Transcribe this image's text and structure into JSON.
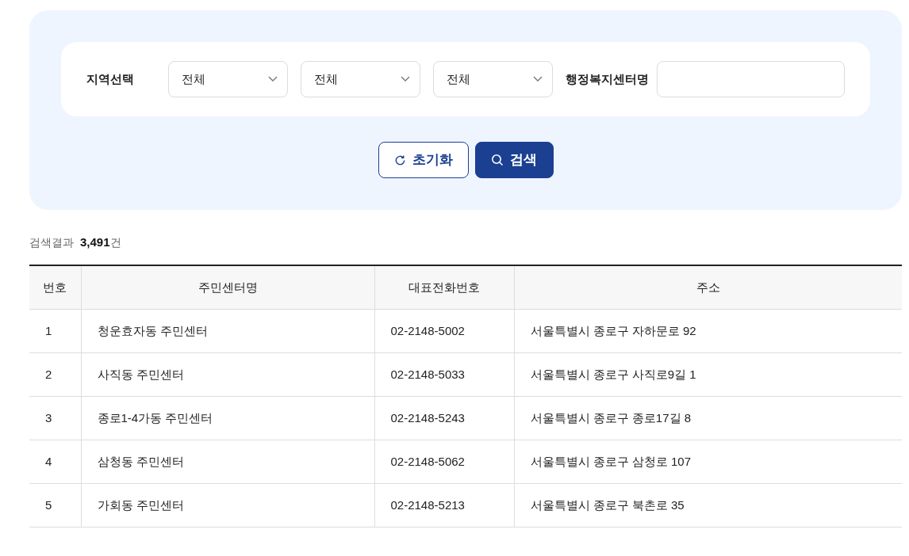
{
  "filter": {
    "region_label": "지역선택",
    "selects": [
      {
        "value": "전체"
      },
      {
        "value": "전체"
      },
      {
        "value": "전체"
      }
    ],
    "center_label": "행정복지센터명",
    "buttons": [
      {
        "kind": "reset",
        "label": "초기화"
      },
      {
        "kind": "search",
        "label": "검색"
      }
    ]
  },
  "result": {
    "label": "검색결과",
    "count": "3,491",
    "unit": "건"
  },
  "table": {
    "columns": [
      "번호",
      "주민센터명",
      "대표전화번호",
      "주소"
    ],
    "rows": [
      [
        "1",
        "청운효자동 주민센터",
        "02-2148-5002",
        "서울특별시 종로구 자하문로 92"
      ],
      [
        "2",
        "사직동 주민센터",
        "02-2148-5033",
        "서울특별시 종로구 사직로9길 1"
      ],
      [
        "3",
        "종로1-4가동 주민센터",
        "02-2148-5243",
        "서울특별시 종로구 종로17길 8"
      ],
      [
        "4",
        "삼청동 주민센터",
        "02-2148-5062",
        "서울특별시 종로구 삼청로 107"
      ],
      [
        "5",
        "가회동 주민센터",
        "02-2148-5213",
        "서울특별시 종로구 북촌로 35"
      ]
    ]
  }
}
